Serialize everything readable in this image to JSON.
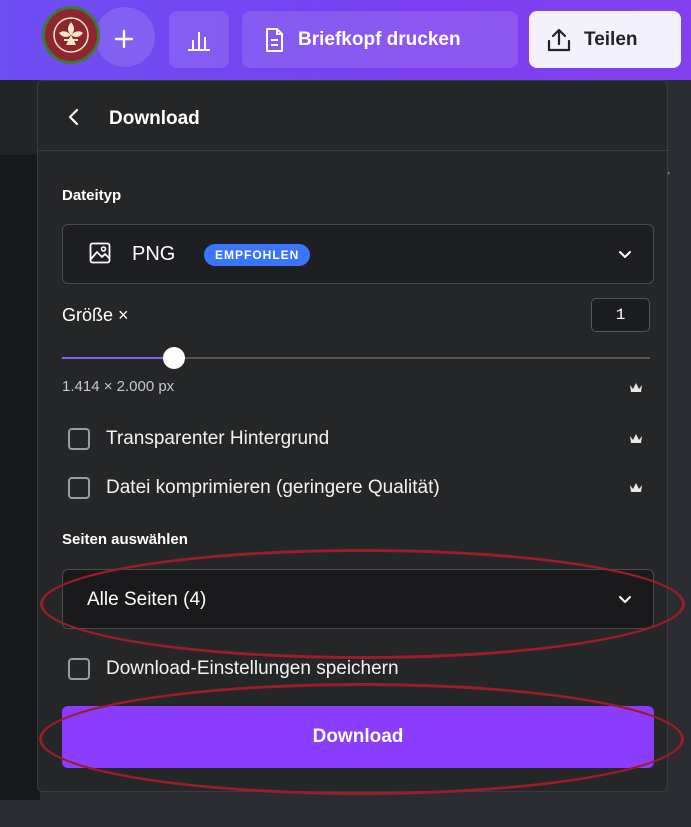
{
  "toolbar": {
    "print_label": "Briefkopf drucken",
    "share_label": "Teilen"
  },
  "download_panel": {
    "title": "Download",
    "filetype": {
      "label": "Dateityp",
      "value": "PNG",
      "badge": "EMPFOHLEN"
    },
    "size": {
      "label": "Größe ×",
      "value": "1",
      "slider_fraction": 0.19,
      "dimensions": "1.414 × 2.000 px"
    },
    "options": [
      {
        "label": "Transparenter Hintergrund",
        "checked": false,
        "premium": true
      },
      {
        "label": "Datei komprimieren (geringere Qualität)",
        "checked": false,
        "premium": true
      }
    ],
    "pages": {
      "label": "Seiten auswählen",
      "value": "Alle Seiten (4)"
    },
    "save_settings_label": "Download-Einstellungen speichern",
    "download_button": "Download"
  },
  "colors": {
    "accent": "#8b3dff",
    "badge": "#3a74ff",
    "highlight": "#9b1c2a",
    "panel_bg": "#252627"
  },
  "icons": [
    "logo-avatar",
    "plus-icon",
    "chart-icon",
    "document-icon",
    "share-upload-icon",
    "chevron-left-icon",
    "image-icon",
    "chevron-down-icon",
    "crown-icon"
  ]
}
